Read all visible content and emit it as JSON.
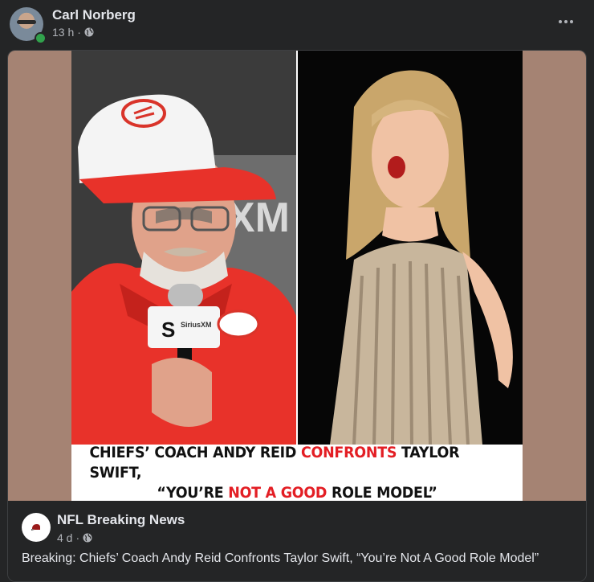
{
  "post": {
    "author": "Carl Norberg",
    "time": "13 h",
    "separator": "·",
    "privacy_icon": "globe-icon",
    "more_icon": "more-horizontal-icon"
  },
  "shared": {
    "headline_line1": {
      "part1": "CHIEFS’ COACH ANDY REID ",
      "highlight": "CONFRONTS",
      "part2": " TAYLOR SWIFT,"
    },
    "headline_line2": {
      "part1": "“YOU’RE ",
      "highlight": "NOT A GOOD",
      "part2": " ROLE MODEL”"
    },
    "page_name": "NFL Breaking News",
    "page_time": "4 d",
    "separator": "·",
    "text": "Breaking: Chiefs’ Coach Andy Reid Confronts Taylor Swift, “You’re Not A Good Role Model”",
    "image_text": {
      "mic_flag": "S",
      "mic_brand": "SiriusXM",
      "backdrop": "sXM"
    }
  },
  "colors": {
    "background": "#242526",
    "highlight": "#e31e24",
    "online": "#31a24c",
    "matte": "#a58373"
  }
}
